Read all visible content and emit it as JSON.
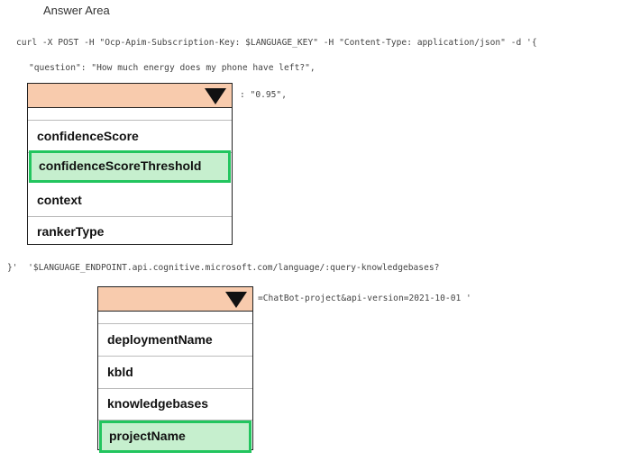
{
  "header": {
    "title": "Answer Area"
  },
  "code": {
    "line1": "curl -X POST -H \"Ocp-Apim-Subscription-Key: $LANGUAGE_KEY\" -H \"Content-Type: application/json\" -d '{",
    "line2": "\"question\": \"How much energy does my phone have left?\",",
    "line3_suffix": ": \"0.95\",",
    "line4": "}'  '$LANGUAGE_ENDPOINT.api.cognitive.microsoft.com/language/:query-knowledgebases?",
    "line5_suffix": "=ChatBot-project&api-version=2021-10-01 '"
  },
  "dropdown1": {
    "selected_index": 1,
    "options": [
      "confidenceScore",
      "confidenceScoreThreshold",
      "context",
      "rankerType"
    ]
  },
  "dropdown2": {
    "selected_index": 3,
    "options": [
      "deploymentName",
      "kbld",
      "knowledgebases",
      "projectName"
    ]
  },
  "colors": {
    "dropdown_header": "#f8cbad",
    "selected_fill": "#c6efce",
    "selected_border": "#22c55e"
  },
  "icons": {
    "dropdown_arrow": "triangle-down-icon"
  }
}
